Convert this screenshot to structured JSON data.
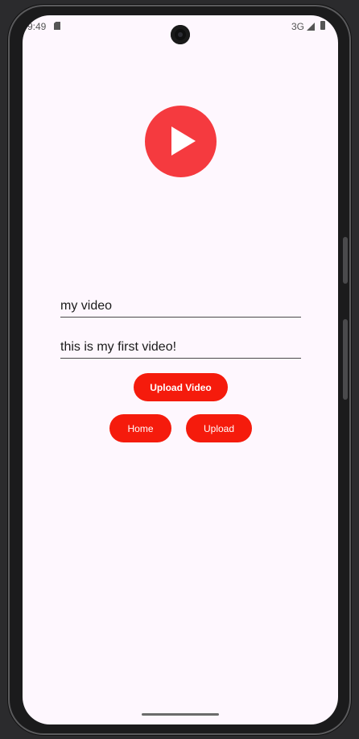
{
  "status_bar": {
    "time": "9:49",
    "network": "3G",
    "icons": [
      "sd-card-icon",
      "signal-icon",
      "battery-icon"
    ]
  },
  "logo": {
    "icon": "play-icon",
    "color": "#f53a3f"
  },
  "form": {
    "title_value": "my video",
    "description_value": "this is my first video!"
  },
  "buttons": {
    "upload_video": "Upload Video",
    "home": "Home",
    "upload": "Upload",
    "color": "#f51b0c"
  }
}
